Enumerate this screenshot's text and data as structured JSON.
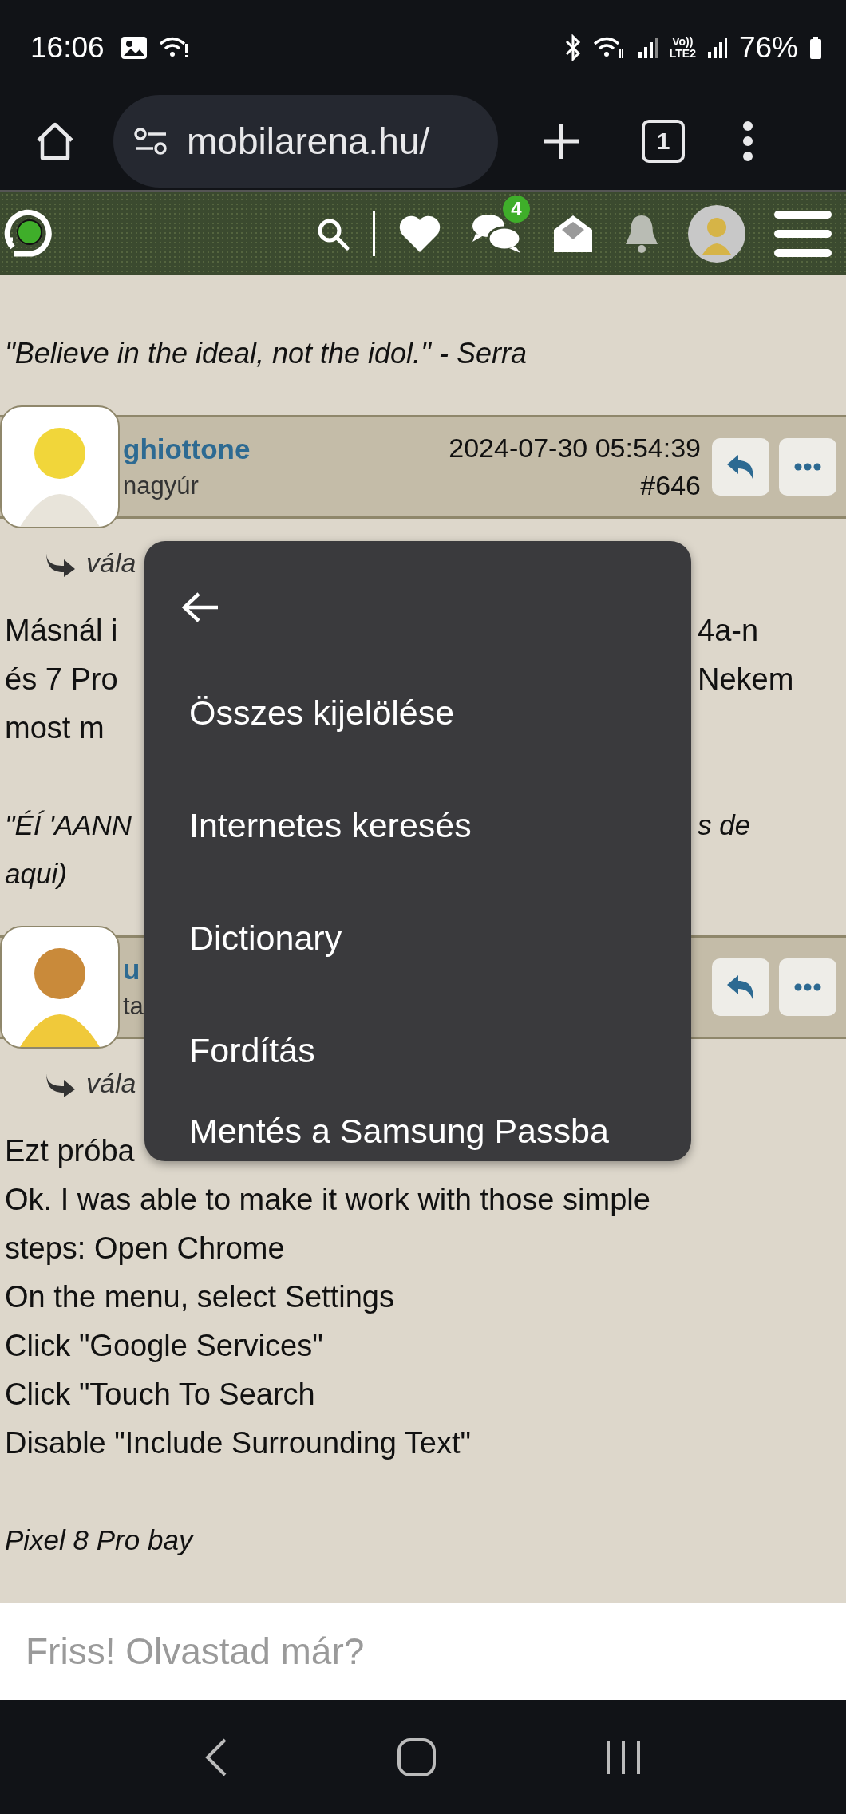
{
  "status_bar": {
    "time": "16:06",
    "volte_top": "Vo))",
    "volte_bottom": "LTE2",
    "battery": "76%"
  },
  "browser": {
    "url": "mobilarena.hu/",
    "tab_count": "1"
  },
  "site_header": {
    "messages_badge": "4"
  },
  "signature_top": "\"Believe in the ideal, not the idol.\" - Serra",
  "posts": [
    {
      "username": "ghiottone",
      "rank": "nagyúr",
      "date": "2024-07-30 05:54:39",
      "number": "#646",
      "reply_link": "vála",
      "lines": [
        {
          "kind": "text",
          "left": "Másnál i",
          "right": "4a-n"
        },
        {
          "kind": "text",
          "left": "és 7 Pro",
          "right": "Nekem"
        },
        {
          "kind": "text",
          "left": "most m"
        },
        {
          "kind": "signature",
          "left": "\"ÉÍ 'AANN",
          "right": "s de"
        },
        {
          "kind": "signature",
          "left": "aqui)"
        }
      ]
    },
    {
      "username": "u",
      "rank": "ta",
      "reply_link": "vála",
      "lines": [
        {
          "kind": "text",
          "left": "Ezt próba"
        },
        {
          "kind": "text",
          "left": "Ok. I was able to make it work with those simple"
        },
        {
          "kind": "text",
          "left": "steps: Open Chrome"
        },
        {
          "kind": "text",
          "left": "On the menu, select Settings"
        },
        {
          "kind": "text",
          "left": "Click \"Google Services\""
        },
        {
          "kind": "text",
          "left": "Click \"Touch To Search"
        },
        {
          "kind": "text",
          "left": "Disable \"Include Surrounding Text\""
        },
        {
          "kind": "signature",
          "left": "Pixel 8 Pro bay"
        }
      ]
    }
  ],
  "context_menu": {
    "items": [
      "Összes kijelölése",
      "Internetes keresés",
      "Dictionary",
      "Fordítás",
      "Mentés a Samsung Passba"
    ]
  },
  "reply_box": {
    "placeholder": "Friss! Olvastad már?"
  }
}
